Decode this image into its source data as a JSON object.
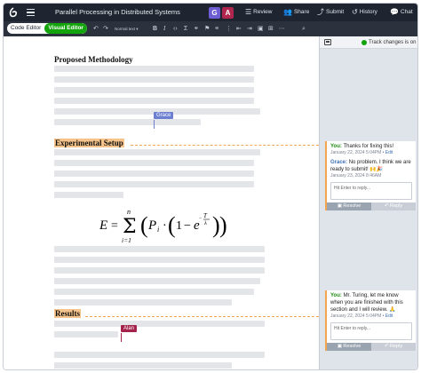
{
  "app": {
    "title": "Parallel Processing in Distributed Systems",
    "logo_icon": "overleaf-leaf-icon",
    "avatars": [
      {
        "letter": "G",
        "color": "#6c5dd3"
      },
      {
        "letter": "A",
        "color": "#b0264e"
      }
    ],
    "top_actions": [
      {
        "label": "Review",
        "icon": "review-icon"
      },
      {
        "label": "Share",
        "icon": "share-icon"
      },
      {
        "label": "Submit",
        "icon": "submit-icon"
      },
      {
        "label": "History",
        "icon": "history-icon"
      },
      {
        "label": "Chat",
        "icon": "chat-icon"
      }
    ]
  },
  "toolbar": {
    "code_editor_label": "Code Editor",
    "visual_editor_label": "Visual Editor",
    "text_style": "Normal text",
    "bold": "B",
    "italic": "I"
  },
  "document": {
    "heading1": "Proposed Methodology",
    "heading2": "Experimental Setup",
    "heading3": "Results",
    "cursors": [
      {
        "name": "Grace",
        "color": "#6c7fd0"
      },
      {
        "name": "Alan",
        "color": "#a3214a"
      }
    ],
    "equation": {
      "lhs": "E",
      "eq": "=",
      "sum_top": "n",
      "sum_bottom": "i=1",
      "p": "P",
      "sub_i": "i",
      "dot": "·",
      "one": "1",
      "minus": "−",
      "e": "e",
      "exp_num": "T",
      "exp_den": "λ"
    }
  },
  "review": {
    "track_changes_label": "Track changes is on",
    "threads": [
      {
        "comments": [
          {
            "author": "You:",
            "author_class": "you",
            "text": "Thanks for fixing this!",
            "date": "January 22, 2024 5:04PM",
            "edit": "Edit"
          },
          {
            "author": "Grace:",
            "author_class": "grace",
            "text": "No problem. I think we are ready to submit! 🙌🎉",
            "date": "January 23, 2024 8:46AM",
            "edit": ""
          }
        ],
        "reply_placeholder": "Hit Enter to reply...",
        "resolve_label": "Resolve",
        "reply_label": "Reply"
      },
      {
        "comments": [
          {
            "author": "You:",
            "author_class": "you",
            "text": "Mr. Turing, let me know when you are finished with this section and I will review. 🙏",
            "date": "January 22, 2024 5:04PM",
            "edit": "Edit"
          }
        ],
        "reply_placeholder": "Hit Enter to reply...",
        "resolve_label": "Resolve",
        "reply_label": "Reply"
      }
    ]
  }
}
